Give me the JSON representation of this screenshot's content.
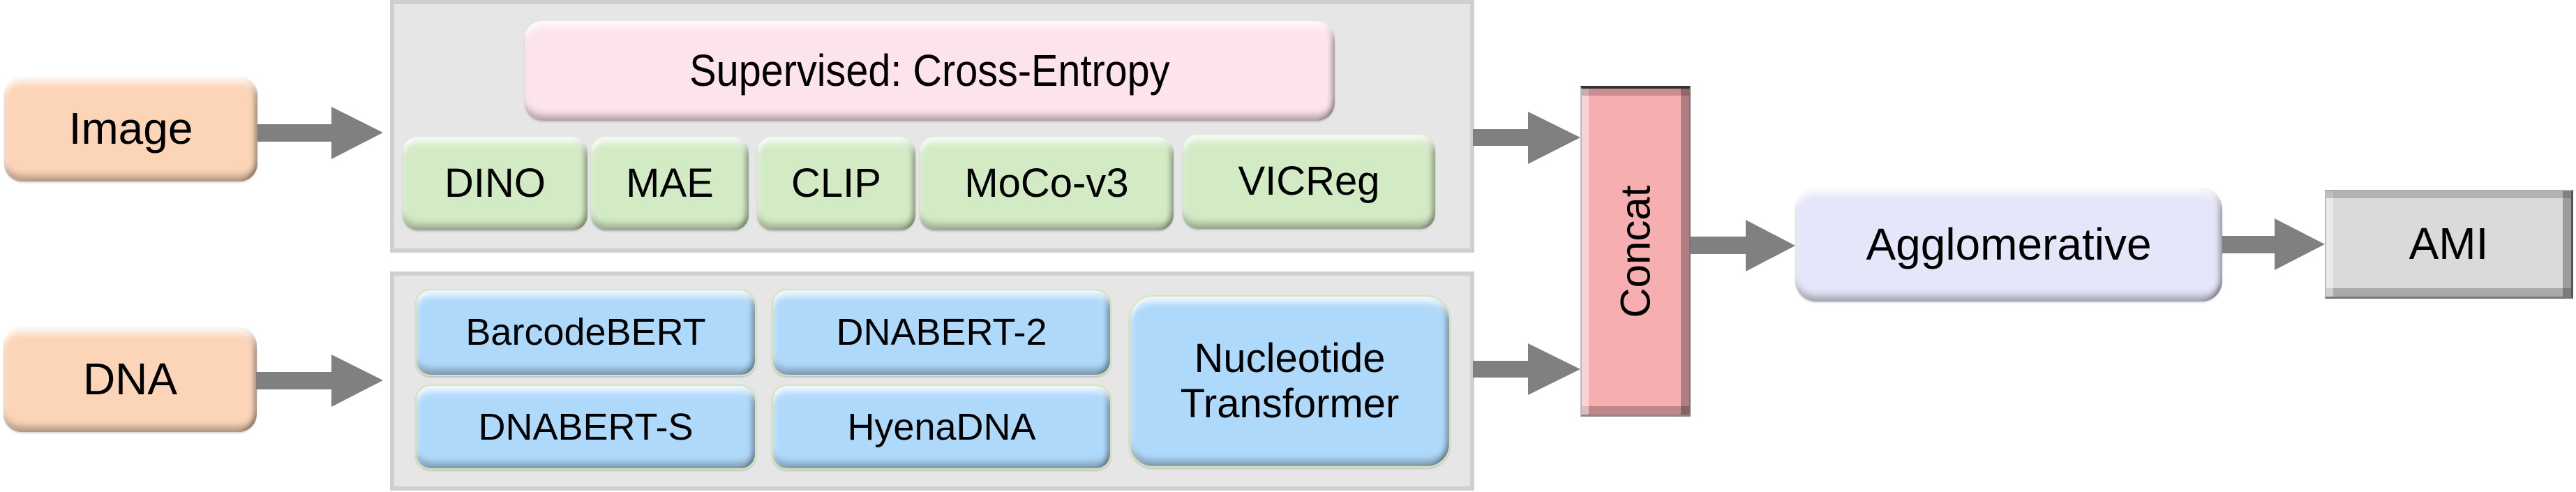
{
  "inputs": {
    "image": "Image",
    "dna": "DNA"
  },
  "image_encoders": {
    "supervised": "Supervised: Cross-Entropy",
    "self_supervised": [
      "DINO",
      "MAE",
      "CLIP",
      "MoCo-v3",
      "VICReg"
    ]
  },
  "dna_encoders": {
    "grid": [
      "BarcodeBERT",
      "DNABERT-2",
      "DNABERT-S",
      "HyenaDNA"
    ],
    "large": [
      "Nucleotide",
      "Transformer"
    ]
  },
  "fusion": "Concat",
  "clustering": "Agglomerative",
  "metric": "AMI",
  "colors": {
    "input": "#fcd5b8",
    "supervised": "#fde4ec",
    "ssl": "#d3ebc4",
    "dna_model": "#afd9fa",
    "concat": "#f6aeb0",
    "clustering": "#e6e6fa",
    "metric": "#dbd9da",
    "arrow": "#808080",
    "panel": "#e6e6e6"
  }
}
